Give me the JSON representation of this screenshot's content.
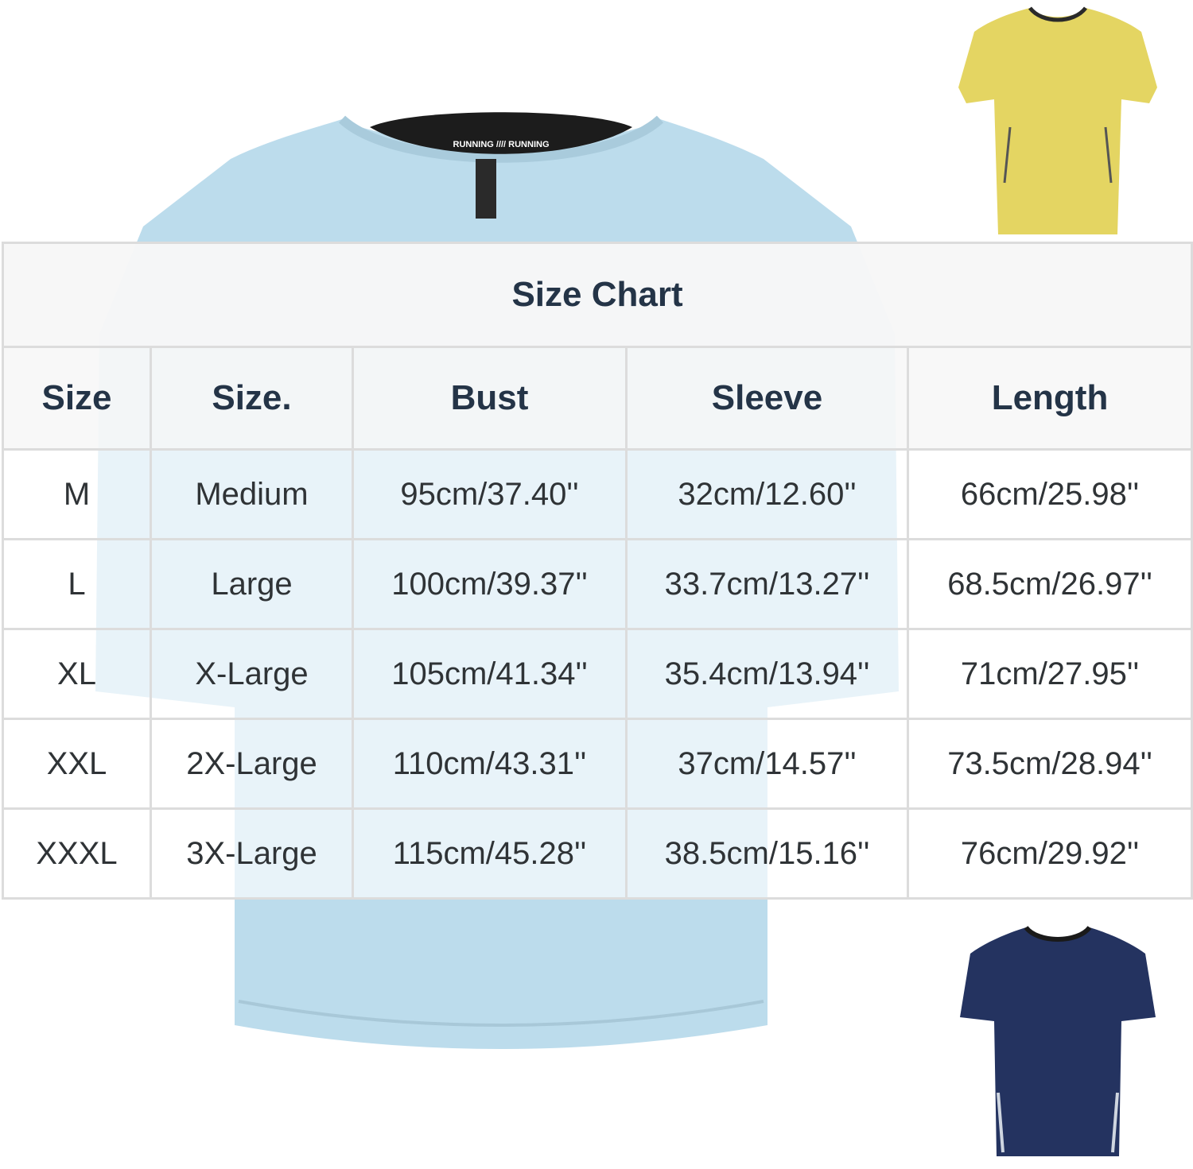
{
  "table": {
    "title": "Size Chart",
    "headers": [
      "Size",
      "Size.",
      "Bust",
      "Sleeve",
      "Length"
    ],
    "rows": [
      [
        "M",
        "Medium",
        "95cm/37.40''",
        "32cm/12.60''",
        "66cm/25.98''"
      ],
      [
        "L",
        "Large",
        "100cm/39.37''",
        "33.7cm/13.27''",
        "68.5cm/26.97''"
      ],
      [
        "XL",
        "X-Large",
        "105cm/41.34''",
        "35.4cm/13.94''",
        "71cm/27.95''"
      ],
      [
        "XXL",
        "2X-Large",
        "110cm/43.31''",
        "37cm/14.57''",
        "73.5cm/28.94''"
      ],
      [
        "XXXL",
        "3X-Large",
        "115cm/45.28''",
        "38.5cm/15.16''",
        "76cm/29.92''"
      ]
    ]
  },
  "images": {
    "main_shirt": {
      "color": "#bcdcec",
      "collar_tape": "RUNNING //// RUNNING"
    },
    "yellow_shirt": {
      "color": "#e4d562"
    },
    "navy_shirt": {
      "color": "#243360"
    }
  }
}
